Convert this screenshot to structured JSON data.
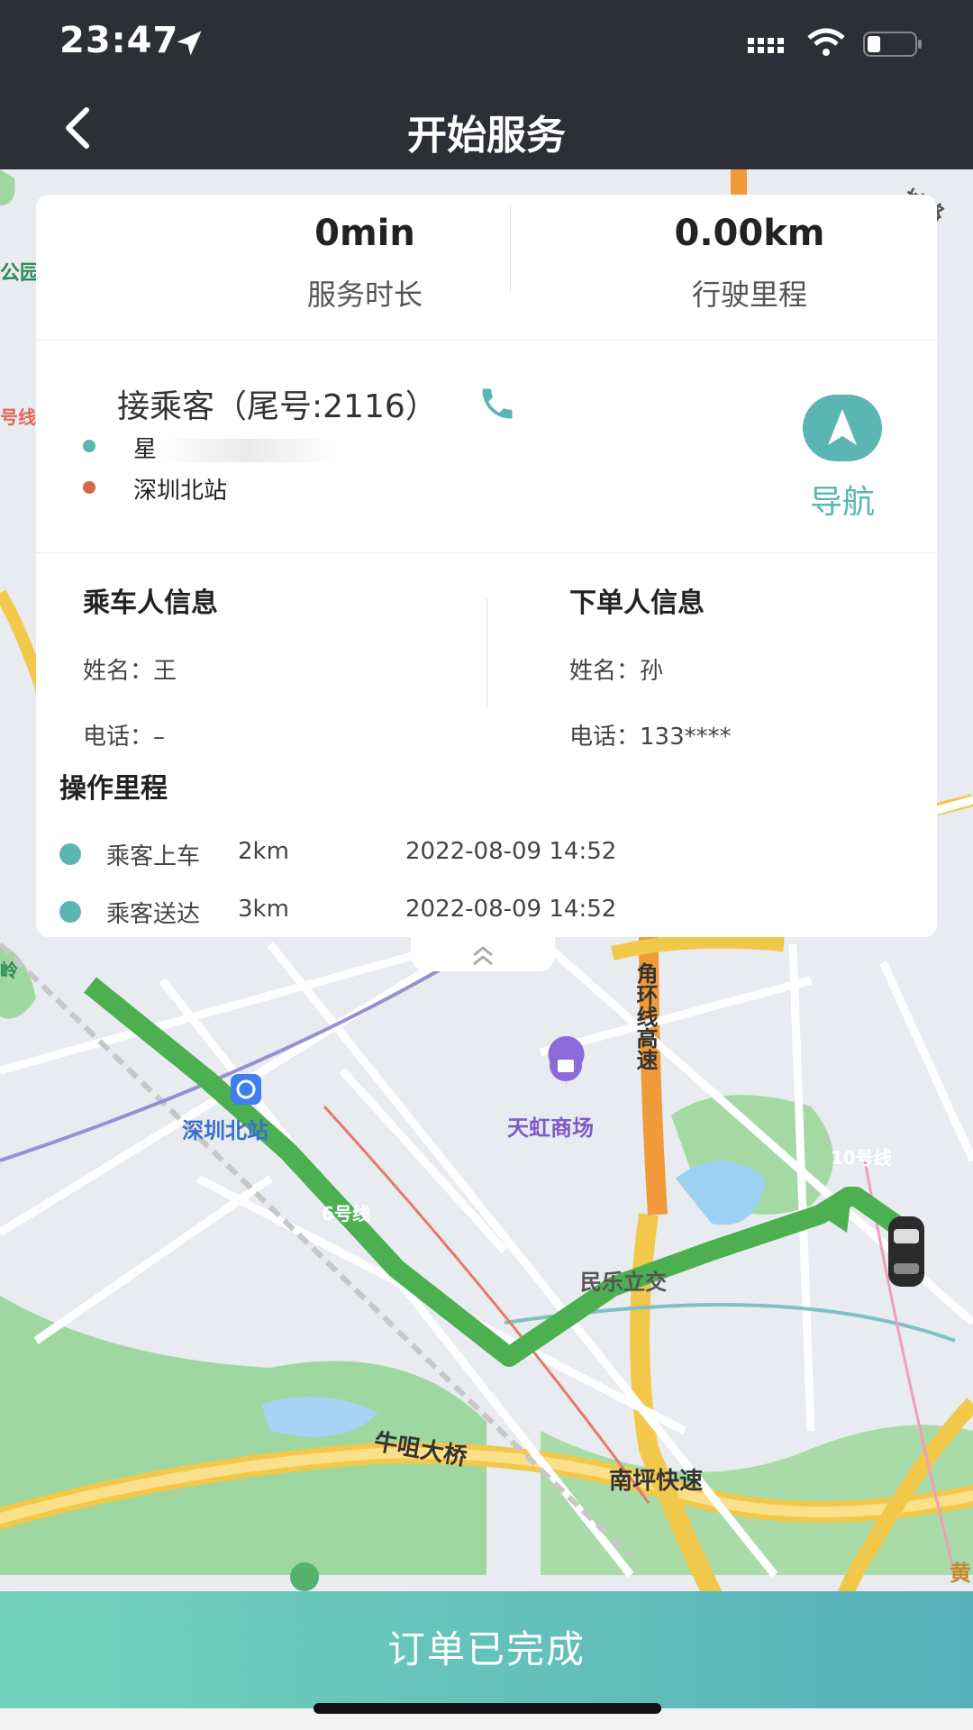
{
  "status_bar": {
    "time": "23:47"
  },
  "header": {
    "title": "开始服务"
  },
  "stats": {
    "duration_value": "0min",
    "duration_label": "服务时长",
    "distance_value": "0.00km",
    "distance_label": "行驶里程"
  },
  "pickup": {
    "title": "接乘客（尾号:2116）",
    "origin": "星",
    "destination": "深圳北站",
    "nav_label": "导航"
  },
  "passenger": {
    "title": "乘车人信息",
    "name_label": "姓名：",
    "name_value": "王",
    "phone_label": "电话：",
    "phone_value": "–"
  },
  "orderer": {
    "title": "下单人信息",
    "name_label": "姓名：",
    "name_value": "孙",
    "phone_label": "电话：",
    "phone_value": "133****"
  },
  "history": {
    "title": "操作里程",
    "rows": [
      {
        "event": "乘客上车",
        "distance": "2km",
        "time": "2022-08-09 14:52"
      },
      {
        "event": "乘客送达",
        "distance": "3km",
        "time": "2022-08-09 14:52"
      }
    ]
  },
  "map": {
    "labels": {
      "station": "深圳北站",
      "mall": "天虹商场",
      "ring_expressway": "角环线高速",
      "line10": "10号线",
      "line6": "6号线",
      "interchange": "民乐立交",
      "bridge": "牛咀大桥",
      "nanping": "南坪快速",
      "park": "公园",
      "line_left": "号线",
      "ling": "岭",
      "chenglu": "城路",
      "huang": "黄"
    }
  },
  "footer": {
    "complete_label": "订单已完成"
  },
  "colors": {
    "accent": "#5bb5b3",
    "route": "#4caf50",
    "header_bg": "#2d2f36",
    "origin_dot": "#5bb5b3",
    "dest_dot": "#d9654d"
  }
}
